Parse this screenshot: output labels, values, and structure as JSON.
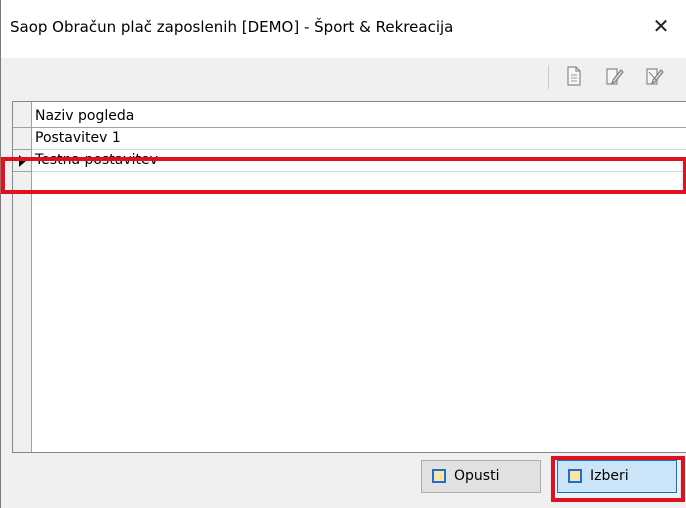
{
  "window": {
    "title": "Saop Obračun plač zaposlenih [DEMO] - Šport & Rekreacija",
    "close_glyph": "✕"
  },
  "toolbar": {
    "icons": [
      "new-document-icon",
      "edit-document-icon",
      "delete-document-icon"
    ]
  },
  "grid": {
    "column_header": "Naziv pogleda",
    "rows": [
      {
        "label": "Postavitev 1",
        "selected": false
      },
      {
        "label": "Testna postavitev",
        "selected": true
      }
    ]
  },
  "buttons": {
    "cancel_label": "Opusti",
    "select_label": "Izberi"
  },
  "colors": {
    "highlight": "#e0111f",
    "focus": "#0078d7",
    "button_icon_border": "#1f6fd1",
    "button_icon_fill": "#ffe59e"
  }
}
